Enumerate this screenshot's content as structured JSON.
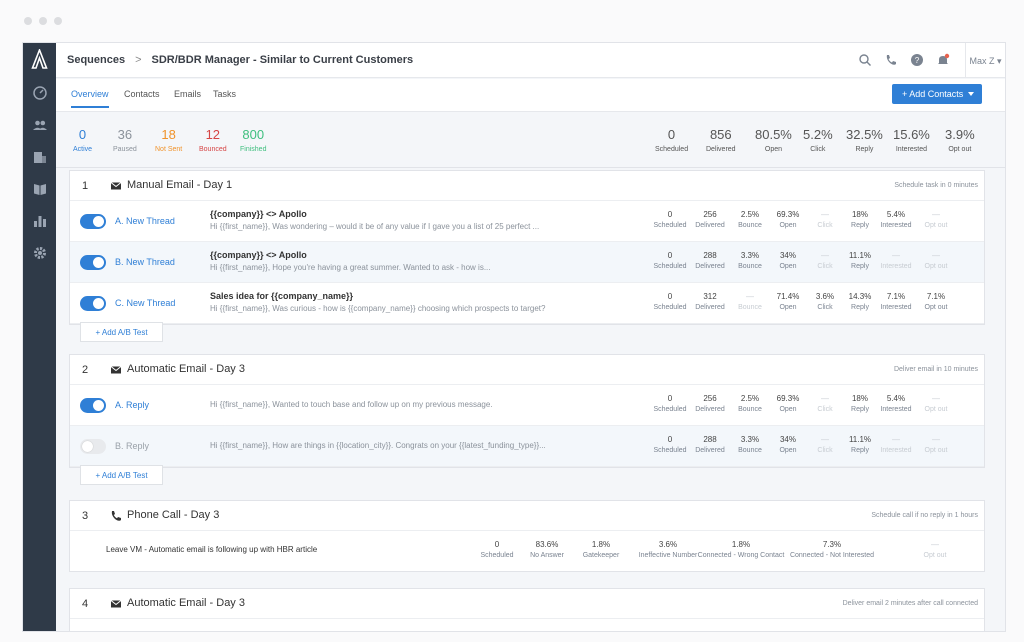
{
  "header": {
    "breadcrumb_root": "Sequences",
    "breadcrumb_sep": ">",
    "title": "SDR/BDR Manager - Similar to Current Customers",
    "user": "Max Z"
  },
  "tabs": [
    "Overview",
    "Contacts",
    "Emails",
    "Tasks"
  ],
  "add_contacts_label": "+ Add Contacts",
  "colors": {
    "accent": "#2f7fd6",
    "sidebar": "#2f3a48",
    "active": "#2f7fd6",
    "paused": "#8b929b",
    "not_sent": "#f0932b",
    "bounced": "#d64545",
    "finished": "#3fbf7f"
  },
  "status_stats": [
    {
      "value": "0",
      "label": "Active",
      "color": "#2f7fd6"
    },
    {
      "value": "36",
      "label": "Paused",
      "color": "#8b929b"
    },
    {
      "value": "18",
      "label": "Not Sent",
      "color": "#f0932b"
    },
    {
      "value": "12",
      "label": "Bounced",
      "color": "#d64545"
    },
    {
      "value": "800",
      "label": "Finished",
      "color": "#3fbf7f"
    }
  ],
  "summary_stats": [
    {
      "value": "0",
      "label": "Scheduled"
    },
    {
      "value": "856",
      "label": "Delivered"
    },
    {
      "value": "80.5%",
      "label": "Open"
    },
    {
      "value": "5.2%",
      "label": "Click"
    },
    {
      "value": "32.5%",
      "label": "Reply"
    },
    {
      "value": "15.6%",
      "label": "Interested"
    },
    {
      "value": "3.9%",
      "label": "Opt out"
    }
  ],
  "metric_keys": [
    "Scheduled",
    "Delivered",
    "Bounce",
    "Open",
    "Click",
    "Reply",
    "Interested",
    "Opt out"
  ],
  "steps": [
    {
      "n": "1",
      "title": "Manual Email - Day 1",
      "note": "Schedule task in 0 minutes",
      "ab": "+ Add A/B Test",
      "variants": [
        {
          "label": "A.  New Thread",
          "subject": "{{company}} <> Apollo",
          "preview": "Hi {{first_name}}, Was wondering – would it be of any value if I gave you a list of 25 perfect ...",
          "values": [
            "0",
            "256",
            "2.5%",
            "69.3%",
            "—",
            "18%",
            "5.4%",
            "—"
          ]
        },
        {
          "label": "B.  New Thread",
          "subject": "{{company}} <> Apollo",
          "preview": "Hi {{first_name}}, Hope you're having a great summer. Wanted to ask - how is...",
          "values": [
            "0",
            "288",
            "3.3%",
            "34%",
            "—",
            "11.1%",
            "—",
            "—"
          ]
        },
        {
          "label": "C.  New Thread",
          "subject": "Sales idea for {{company_name}}",
          "preview": "Hi {{first_name}}, Was curious - how is {{company_name}} choosing which prospects to target?",
          "values": [
            "0",
            "312",
            "—",
            "71.4%",
            "3.6%",
            "14.3%",
            "7.1%",
            "7.1%"
          ]
        }
      ]
    },
    {
      "n": "2",
      "title": "Automatic Email - Day 3",
      "note": "Deliver email in 10 minutes",
      "ab": "+ Add A/B Test",
      "variants": [
        {
          "label": "A.  Reply",
          "subject": "",
          "preview": "Hi {{first_name}}, Wanted to touch base and follow up on my previous message.",
          "values": [
            "0",
            "256",
            "2.5%",
            "69.3%",
            "—",
            "18%",
            "5.4%",
            "—"
          ]
        },
        {
          "label": "B.  Reply",
          "subject": "",
          "preview": "Hi {{first_name}}, How are things in {{location_city}}. Congrats on your {{latest_funding_type}}...",
          "values": [
            "0",
            "288",
            "3.3%",
            "34%",
            "—",
            "11.1%",
            "—",
            "—"
          ]
        }
      ]
    },
    {
      "n": "3",
      "title": "Phone Call - Day 3",
      "note": "Schedule call if no reply in 1 hours",
      "call": {
        "text": "Leave VM - Automatic email is following up with HBR article",
        "metrics": [
          {
            "value": "0",
            "label": "Scheduled"
          },
          {
            "value": "83.6%",
            "label": "No Answer"
          },
          {
            "value": "1.8%",
            "label": "Gatekeeper"
          },
          {
            "value": "3.6%",
            "label": "Ineffective Number"
          },
          {
            "value": "1.8%",
            "label": "Connected - Wrong Contact"
          },
          {
            "value": "7.3%",
            "label": "Connected - Not Interested"
          },
          {
            "value": "—",
            "label": "Opt out"
          }
        ]
      }
    },
    {
      "n": "4",
      "title": "Automatic Email - Day 3",
      "note": "Deliver email 2 minutes after call connected"
    }
  ]
}
